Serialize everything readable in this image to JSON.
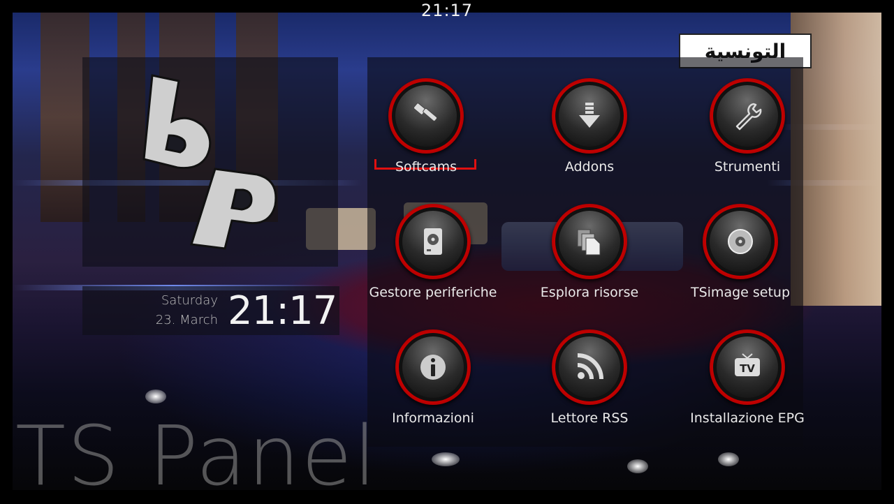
{
  "header": {
    "clock": "21:17"
  },
  "channel_logo": {
    "text": "التونسية"
  },
  "brand_logo": {
    "icon": "bp-logo-icon"
  },
  "datetime": {
    "day": "Saturday",
    "date": "23. March",
    "time": "21:17"
  },
  "menu": {
    "selected_index": 0,
    "items": [
      {
        "label": "Softcams",
        "icon": "key-wrench-icon"
      },
      {
        "label": "Addons",
        "icon": "download-arrow-icon"
      },
      {
        "label": "Strumenti",
        "icon": "wrench-icon"
      },
      {
        "label": "Gestore periferiche",
        "icon": "harddisk-icon"
      },
      {
        "label": "Esplora risorse",
        "icon": "files-icon"
      },
      {
        "label": "TSimage setup",
        "icon": "disc-icon"
      },
      {
        "label": "Informazioni",
        "icon": "info-icon"
      },
      {
        "label": "Lettore RSS",
        "icon": "rss-icon"
      },
      {
        "label": "Installazione EPG",
        "icon": "tv-icon"
      }
    ]
  },
  "footer": {
    "title": "TS Panel"
  },
  "colors": {
    "accent": "#d10000",
    "panel": "#0f0f19"
  }
}
